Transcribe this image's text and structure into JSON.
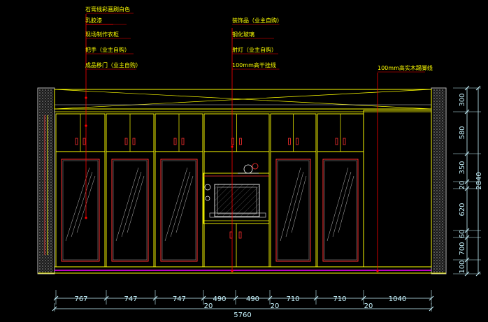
{
  "annotations_left": [
    "石膏线彩画刷白色",
    "乳胶漆",
    "现场制作衣柜",
    "把手（业主自购）",
    "成品移门（业主自购）"
  ],
  "annotations_center": [
    "装饰品（业主自购）",
    "钢化玻璃",
    "射灯（业主自购）",
    "100mm高干挂线"
  ],
  "annotations_right": [
    "100mm高实木踢脚线"
  ],
  "dims_bottom": [
    "767",
    "747",
    "747",
    "490",
    "490",
    "710",
    "710",
    "1040"
  ],
  "dims_gaps": [
    "20",
    "20",
    "20"
  ],
  "dim_total_bottom": "5760",
  "dims_right": [
    "300",
    "580",
    "350",
    "20",
    "620",
    "60",
    "700",
    "100"
  ],
  "dim_total_right": "2840",
  "colors": {
    "background": "#000000",
    "outline": "#ffff00",
    "leader": "#ff0000",
    "dimension": "#c8f5ff",
    "glass": "#ff3030",
    "wall": "#9a9a9a",
    "floor": "#ff00ff"
  }
}
